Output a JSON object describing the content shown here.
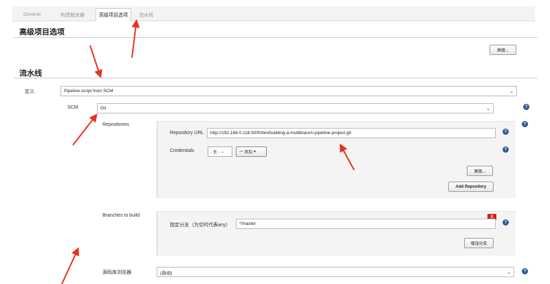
{
  "tabs": [
    "General",
    "构建触发器",
    "高级项目选项",
    "流水线"
  ],
  "active_tab": 2,
  "advanced": {
    "title": "高级项目选项",
    "advanced_btn": "高级..."
  },
  "pipeline": {
    "title": "流水线",
    "definition_label": "定义",
    "definition_value": "Pipeline script from SCM",
    "scm_label": "SCM",
    "scm_value": "Git",
    "repositories_label": "Repositories",
    "repo_url_label": "Repository URL",
    "repo_url_value": "http://192.168.0.118:3000/bin/building-a-multibranch-pipeline-project.git",
    "credentials_label": "Credentials",
    "credentials_value": "- 无 -",
    "add_cred_label": "添加",
    "repo_advanced_btn": "高级...",
    "add_repository_btn": "Add Repository",
    "branches_label": "Branches to build",
    "branch_spec_label": "指定分支（为空时代表any）",
    "branch_spec_value": "*/master",
    "branch_delete": "X",
    "add_branch_btn": "增加分支",
    "browser_label": "源码库浏览器",
    "browser_value": "(自动)"
  },
  "colors": {
    "arrow": "#e8321e",
    "help": "#2a5a9a",
    "delete": "#d21f1f"
  }
}
